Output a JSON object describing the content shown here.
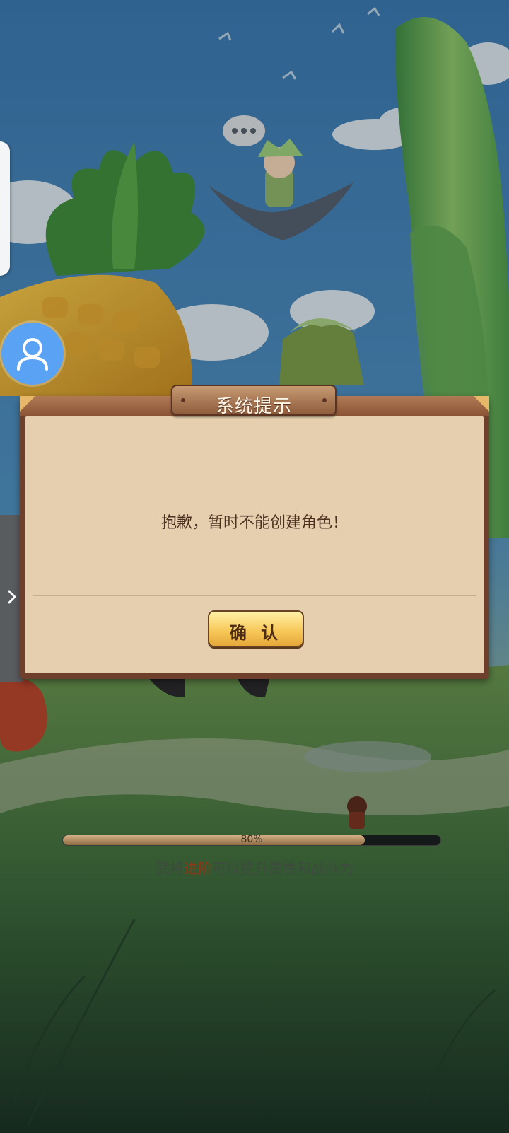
{
  "dialog": {
    "title": "系统提示",
    "message": "抱歉，暂时不能创建角色！",
    "confirm_label": "确 认"
  },
  "loading": {
    "progress_fraction": 0.8,
    "percent_text": "80%",
    "tip_before": "武将",
    "tip_highlight": "进阶",
    "tip_after": "可以提升属性和战斗力"
  },
  "colors": {
    "accent_button": "#f7c95a",
    "dialog_frame": "#6e3f2a",
    "dialog_body": "#e6cfae",
    "float_avatar": "#5aa2f3",
    "tip_highlight": "#8a3a18"
  },
  "icons": {
    "avatar": "user-icon",
    "drawer": "chevron-right-icon"
  }
}
